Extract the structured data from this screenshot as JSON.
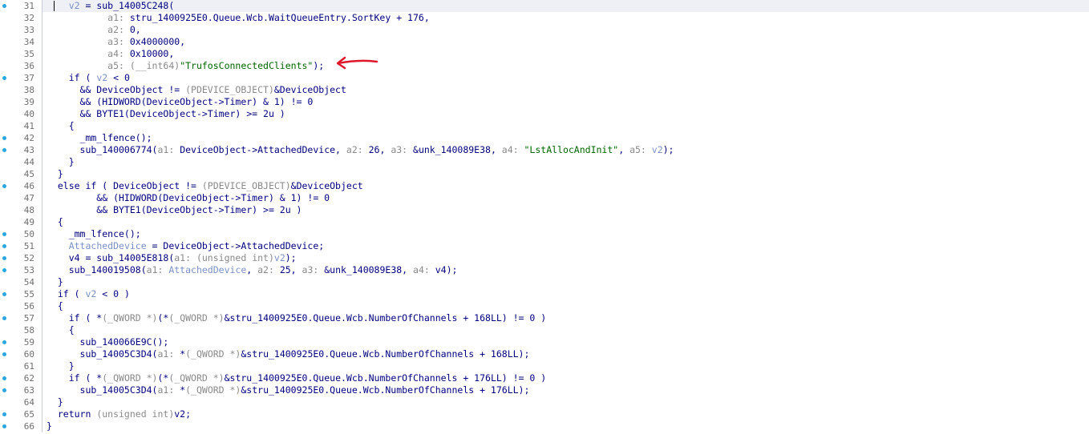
{
  "accent_colors": {
    "breakpoint_dot": "#2aa7e0",
    "code_text": "#000080",
    "string_literal": "#006400",
    "type_cast": "#8a8a8a",
    "highlight_var": "#7a91c6",
    "annotation_arrow": "#e0162b"
  },
  "icons": {
    "breakpoint": "circle-dot",
    "annotation": "red-arrow"
  },
  "lines": [
    {
      "num": "31",
      "dot": true,
      "sel": true,
      "tokens": [
        [
          "    ",
          "x"
        ],
        [
          "v2",
          "hl"
        ],
        [
          " = sub_14005C248(",
          "id"
        ]
      ]
    },
    {
      "num": "32",
      "dot": false,
      "tokens": [
        [
          "           ",
          "x"
        ],
        [
          "a1: ",
          "ty"
        ],
        [
          "stru_1400925E0.Queue.Wcb.WaitQueueEntry.SortKey + 176,",
          "id"
        ]
      ]
    },
    {
      "num": "33",
      "dot": false,
      "tokens": [
        [
          "           ",
          "x"
        ],
        [
          "a2: ",
          "ty"
        ],
        [
          "0,",
          "id"
        ]
      ]
    },
    {
      "num": "34",
      "dot": false,
      "tokens": [
        [
          "           ",
          "x"
        ],
        [
          "a3: ",
          "ty"
        ],
        [
          "0x4000000,",
          "id"
        ]
      ]
    },
    {
      "num": "35",
      "dot": false,
      "tokens": [
        [
          "           ",
          "x"
        ],
        [
          "a4: ",
          "ty"
        ],
        [
          "0x10000,",
          "id"
        ]
      ]
    },
    {
      "num": "36",
      "dot": false,
      "tokens": [
        [
          "           ",
          "x"
        ],
        [
          "a5: (__int64)",
          "ty"
        ],
        [
          "\"TrufosConnectedClients\"",
          "str"
        ],
        [
          ");",
          "id"
        ]
      ]
    },
    {
      "num": "37",
      "dot": true,
      "tokens": [
        [
          "    if ( ",
          "kw"
        ],
        [
          "v2",
          "hl"
        ],
        [
          " < 0",
          "id"
        ]
      ]
    },
    {
      "num": "38",
      "dot": false,
      "tokens": [
        [
          "      && DeviceObject != ",
          "id"
        ],
        [
          "(PDEVICE_OBJECT)",
          "ty"
        ],
        [
          "&DeviceObject",
          "id"
        ]
      ]
    },
    {
      "num": "39",
      "dot": false,
      "tokens": [
        [
          "      && (HIDWORD(DeviceObject->Timer) & 1) != 0",
          "id"
        ]
      ]
    },
    {
      "num": "40",
      "dot": false,
      "tokens": [
        [
          "      && BYTE1(DeviceObject->Timer) >= 2u )",
          "id"
        ]
      ]
    },
    {
      "num": "41",
      "dot": false,
      "tokens": [
        [
          "    {",
          "id"
        ]
      ]
    },
    {
      "num": "42",
      "dot": true,
      "tokens": [
        [
          "      _mm_lfence();",
          "id"
        ]
      ]
    },
    {
      "num": "43",
      "dot": true,
      "tokens": [
        [
          "      sub_140006774(",
          "id"
        ],
        [
          "a1: ",
          "ty"
        ],
        [
          "DeviceObject->AttachedDevice, ",
          "id"
        ],
        [
          "a2: ",
          "ty"
        ],
        [
          "26, ",
          "id"
        ],
        [
          "a3: ",
          "ty"
        ],
        [
          "&unk_140089E38, ",
          "id"
        ],
        [
          "a4: ",
          "ty"
        ],
        [
          "\"LstAllocAndInit\"",
          "str"
        ],
        [
          ", ",
          "id"
        ],
        [
          "a5: ",
          "ty"
        ],
        [
          "v2",
          "hl"
        ],
        [
          ");",
          "id"
        ]
      ]
    },
    {
      "num": "44",
      "dot": false,
      "tokens": [
        [
          "    }",
          "id"
        ]
      ]
    },
    {
      "num": "45",
      "dot": false,
      "tokens": [
        [
          "  }",
          "id"
        ]
      ]
    },
    {
      "num": "46",
      "dot": true,
      "tokens": [
        [
          "  else if ( DeviceObject != ",
          "id"
        ],
        [
          "(PDEVICE_OBJECT)",
          "ty"
        ],
        [
          "&DeviceObject",
          "id"
        ]
      ]
    },
    {
      "num": "47",
      "dot": false,
      "tokens": [
        [
          "         && (HIDWORD(DeviceObject->Timer) & 1) != 0",
          "id"
        ]
      ]
    },
    {
      "num": "48",
      "dot": false,
      "tokens": [
        [
          "         && BYTE1(DeviceObject->Timer) >= 2u )",
          "id"
        ]
      ]
    },
    {
      "num": "49",
      "dot": false,
      "tokens": [
        [
          "  {",
          "id"
        ]
      ]
    },
    {
      "num": "50",
      "dot": true,
      "tokens": [
        [
          "    _mm_lfence();",
          "id"
        ]
      ]
    },
    {
      "num": "51",
      "dot": true,
      "tokens": [
        [
          "    ",
          "x"
        ],
        [
          "AttachedDevice",
          "hl"
        ],
        [
          " = DeviceObject->AttachedDevice;",
          "id"
        ]
      ]
    },
    {
      "num": "52",
      "dot": true,
      "tokens": [
        [
          "    v4 = sub_14005E818(",
          "id"
        ],
        [
          "a1: ",
          "ty"
        ],
        [
          "(unsigned int)",
          "ty"
        ],
        [
          "v2",
          "hl"
        ],
        [
          ");",
          "id"
        ]
      ]
    },
    {
      "num": "53",
      "dot": true,
      "tokens": [
        [
          "    sub_140019508(",
          "id"
        ],
        [
          "a1: ",
          "ty"
        ],
        [
          "AttachedDevice",
          "hl"
        ],
        [
          ", ",
          "id"
        ],
        [
          "a2: ",
          "ty"
        ],
        [
          "25, ",
          "id"
        ],
        [
          "a3: ",
          "ty"
        ],
        [
          "&unk_140089E38, ",
          "id"
        ],
        [
          "a4: ",
          "ty"
        ],
        [
          "v4);",
          "id"
        ]
      ]
    },
    {
      "num": "54",
      "dot": false,
      "tokens": [
        [
          "  }",
          "id"
        ]
      ]
    },
    {
      "num": "55",
      "dot": true,
      "tokens": [
        [
          "  if ( ",
          "kw"
        ],
        [
          "v2",
          "hl"
        ],
        [
          " < 0 )",
          "id"
        ]
      ]
    },
    {
      "num": "56",
      "dot": false,
      "tokens": [
        [
          "  {",
          "id"
        ]
      ]
    },
    {
      "num": "57",
      "dot": true,
      "tokens": [
        [
          "    if ( *",
          "id"
        ],
        [
          "(_QWORD *)",
          "ty"
        ],
        [
          "(*",
          "id"
        ],
        [
          "(_QWORD *)",
          "ty"
        ],
        [
          "&stru_1400925E0.Queue.Wcb.NumberOfChannels + 168LL) != 0 )",
          "id"
        ]
      ]
    },
    {
      "num": "58",
      "dot": false,
      "tokens": [
        [
          "    {",
          "id"
        ]
      ]
    },
    {
      "num": "59",
      "dot": true,
      "tokens": [
        [
          "      sub_140066E9C();",
          "id"
        ]
      ]
    },
    {
      "num": "60",
      "dot": true,
      "tokens": [
        [
          "      sub_14005C3D4(",
          "id"
        ],
        [
          "a1: ",
          "ty"
        ],
        [
          "*",
          "id"
        ],
        [
          "(_QWORD *)",
          "ty"
        ],
        [
          "&stru_1400925E0.Queue.Wcb.NumberOfChannels + 168LL);",
          "id"
        ]
      ]
    },
    {
      "num": "61",
      "dot": false,
      "tokens": [
        [
          "    }",
          "id"
        ]
      ]
    },
    {
      "num": "62",
      "dot": true,
      "tokens": [
        [
          "    if ( *",
          "id"
        ],
        [
          "(_QWORD *)",
          "ty"
        ],
        [
          "(*",
          "id"
        ],
        [
          "(_QWORD *)",
          "ty"
        ],
        [
          "&stru_1400925E0.Queue.Wcb.NumberOfChannels + 176LL) != 0 )",
          "id"
        ]
      ]
    },
    {
      "num": "63",
      "dot": true,
      "tokens": [
        [
          "      sub_14005C3D4(",
          "id"
        ],
        [
          "a1: ",
          "ty"
        ],
        [
          "*",
          "id"
        ],
        [
          "(_QWORD *)",
          "ty"
        ],
        [
          "&stru_1400925E0.Queue.Wcb.NumberOfChannels + 176LL);",
          "id"
        ]
      ]
    },
    {
      "num": "64",
      "dot": false,
      "tokens": [
        [
          "  }",
          "id"
        ]
      ]
    },
    {
      "num": "65",
      "dot": true,
      "tokens": [
        [
          "  return ",
          "kw"
        ],
        [
          "(unsigned int)",
          "ty"
        ],
        [
          "v2;",
          "id"
        ]
      ]
    },
    {
      "num": "66",
      "dot": true,
      "tokens": [
        [
          "}",
          "id"
        ]
      ]
    }
  ]
}
